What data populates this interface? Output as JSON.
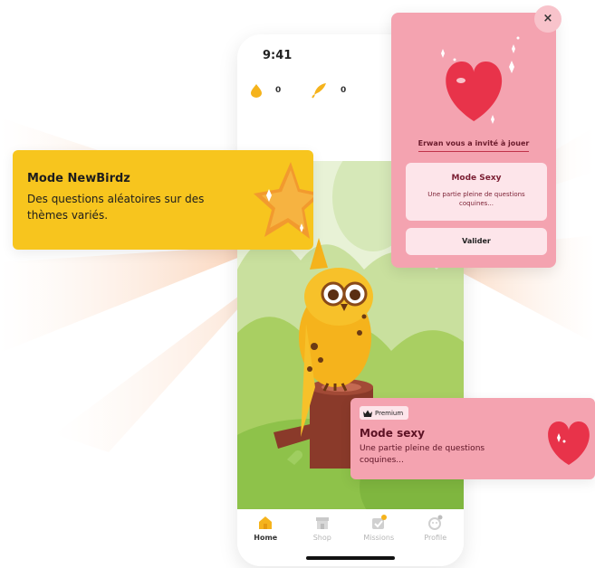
{
  "status_bar": {
    "time": "9:41"
  },
  "counters": [
    {
      "icon": "coin-icon",
      "value": "0"
    },
    {
      "icon": "feather-icon",
      "value": "0"
    }
  ],
  "mode_card": {
    "title": "Mode NewBirdz",
    "description": "Des questions aléatoires sur des thèmes variés."
  },
  "invite_modal": {
    "close_label": "×",
    "invite_text": "Erwan vous a invité à jouer",
    "mode_title": "Mode Sexy",
    "mode_description": "Une partie pleine de questions coquines...",
    "confirm_label": "Valider"
  },
  "premium_card": {
    "badge": "Premium",
    "title": "Mode sexy",
    "description": "Une partie pleine de questions coquines..."
  },
  "tabs": [
    {
      "label": "Home",
      "icon": "home-icon",
      "active": true
    },
    {
      "label": "Shop",
      "icon": "shop-icon",
      "active": false
    },
    {
      "label": "Missions",
      "icon": "missions-icon",
      "active": false
    },
    {
      "label": "Profile",
      "icon": "profile-icon",
      "active": false
    }
  ],
  "colors": {
    "yellow_accent": "#f7c51e",
    "pink_accent": "#f4a3b0",
    "heart_red": "#e8334a",
    "scene_green": "#a9cf62"
  }
}
